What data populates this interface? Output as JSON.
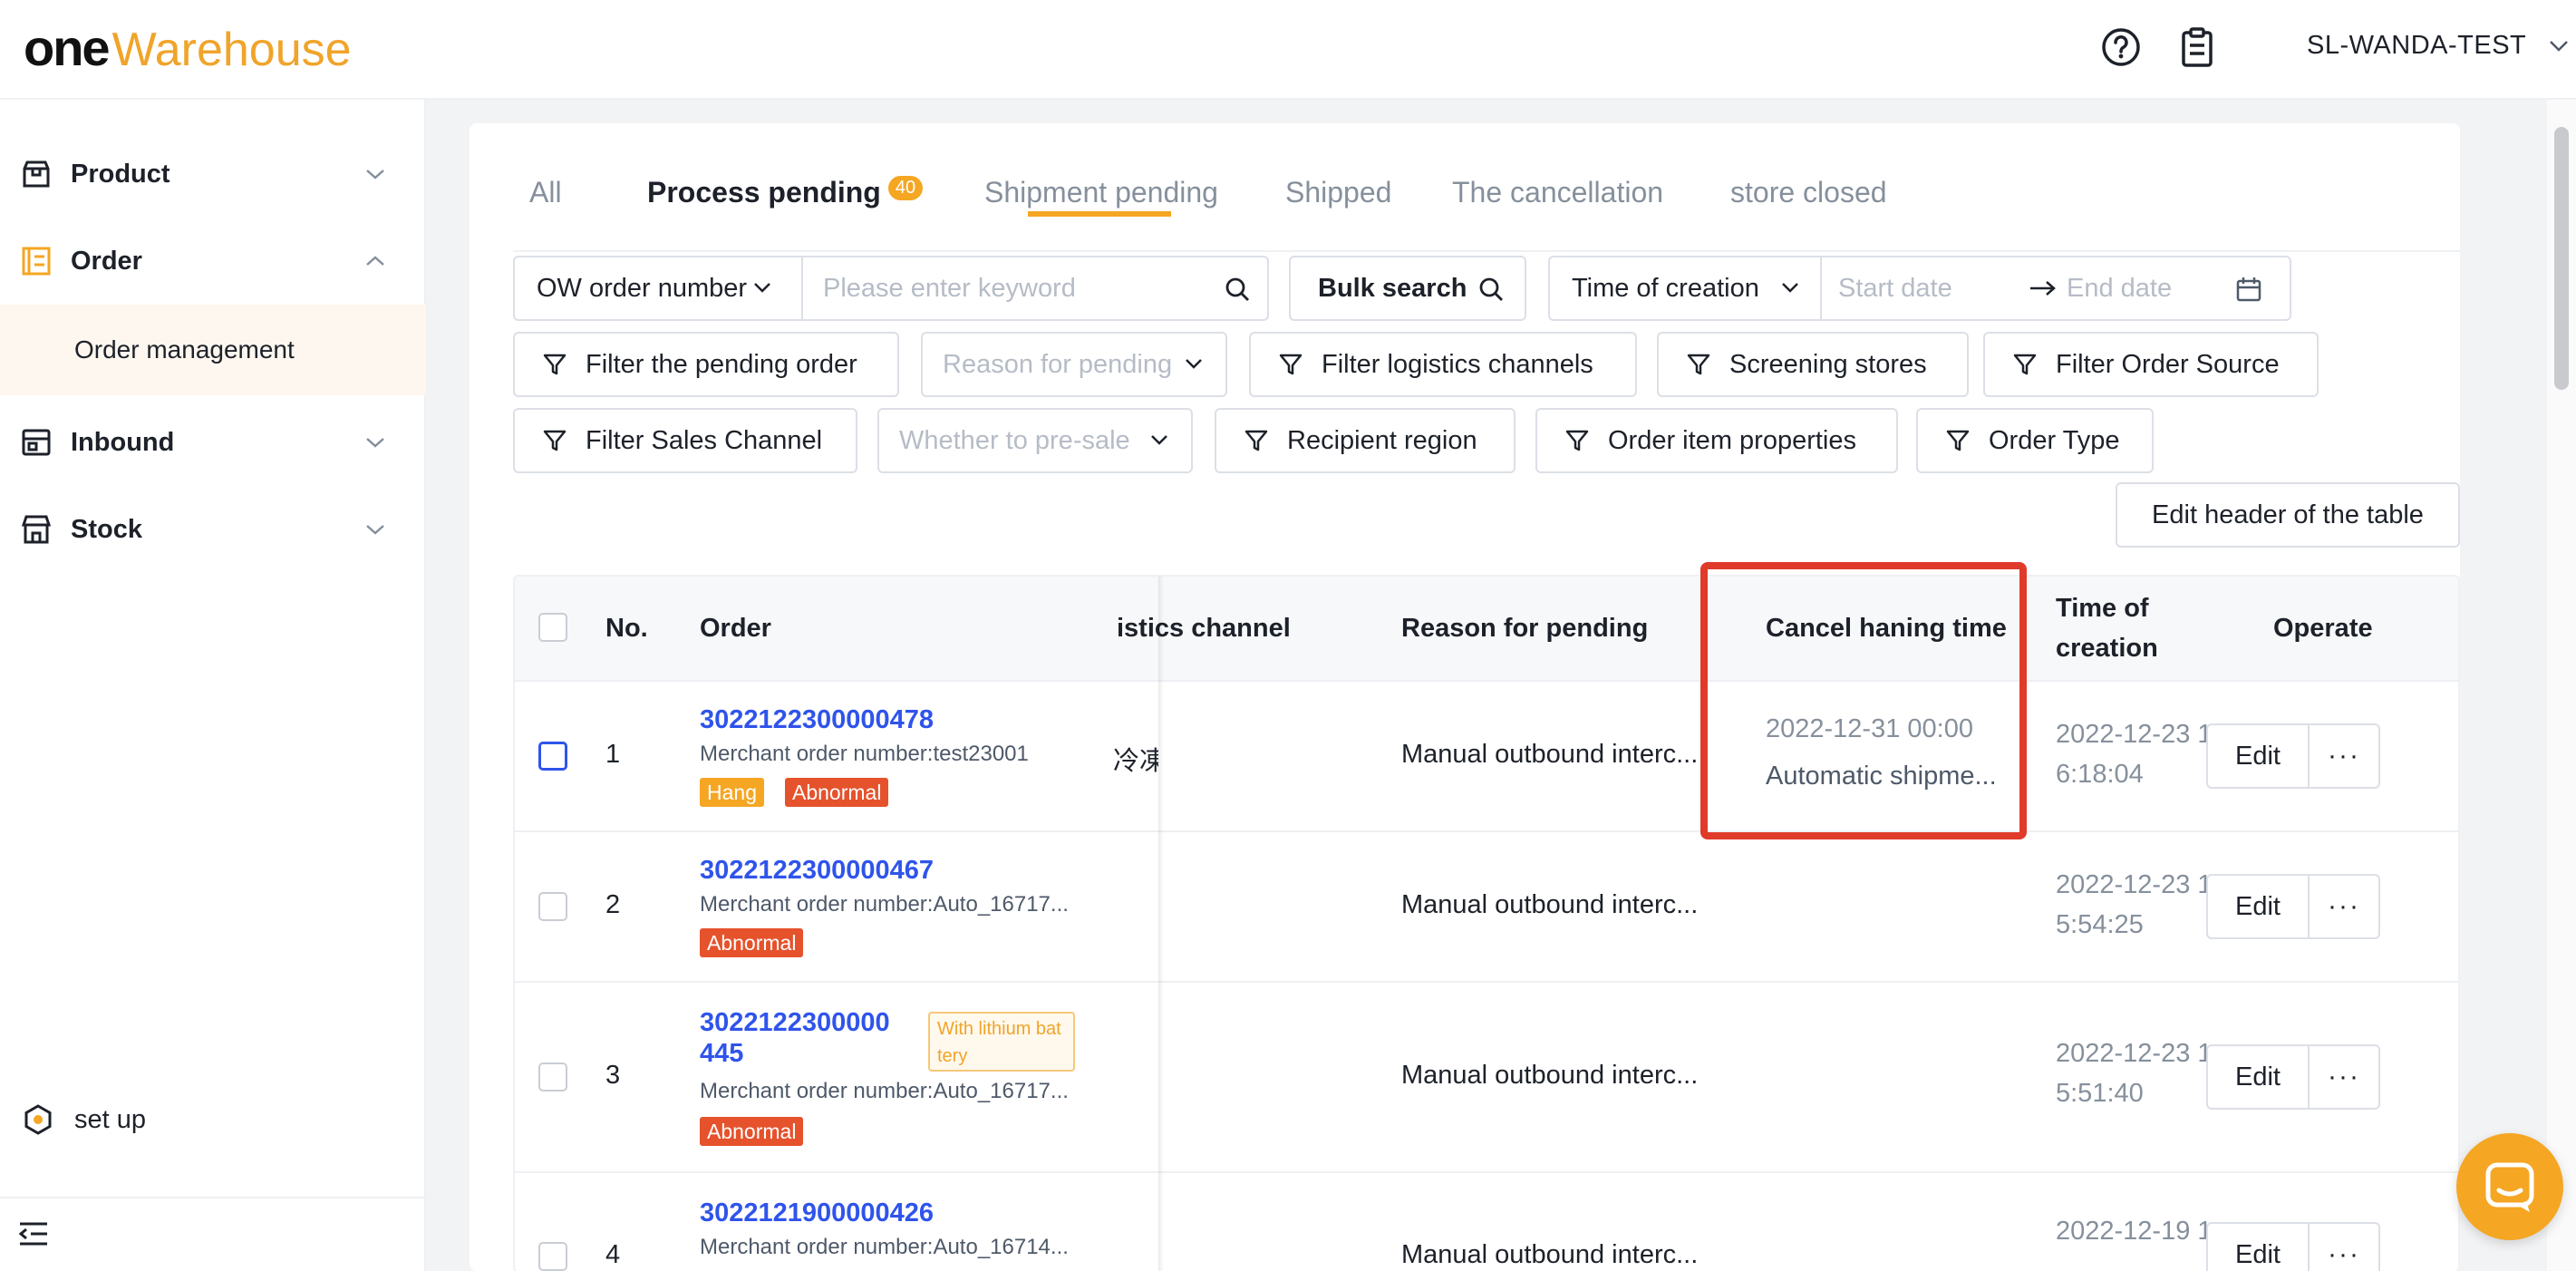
{
  "brand": {
    "logo_one": "one",
    "logo_rest": "Warehouse",
    "accent": "#f5a623"
  },
  "header": {
    "user": "SL-WANDA-TEST",
    "help_icon": "help-circle-icon",
    "notes_icon": "clipboard-icon"
  },
  "sidebar": {
    "items": [
      {
        "label": "Product",
        "icon": "box-icon",
        "expanded": false
      },
      {
        "label": "Order",
        "icon": "order-list-icon",
        "expanded": true
      },
      {
        "label": "Inbound",
        "icon": "inbound-icon",
        "expanded": false
      },
      {
        "label": "Stock",
        "icon": "store-icon",
        "expanded": false
      }
    ],
    "sub_item": "Order management",
    "setup": "set up"
  },
  "tabs": [
    {
      "label": "All"
    },
    {
      "label": "Process pending",
      "badge": "40",
      "active": true
    },
    {
      "label": "Shipment pending"
    },
    {
      "label": "Shipped"
    },
    {
      "label": "The cancellation"
    },
    {
      "label": "store closed"
    }
  ],
  "filters": {
    "order_field_select": "OW order number",
    "keyword_placeholder": "Please enter keyword",
    "bulk_search": "Bulk search",
    "time_select": "Time of creation",
    "start_date_placeholder": "Start date",
    "end_date_placeholder": "End date",
    "filter_pending": "Filter the pending order",
    "reason_placeholder": "Reason for pending",
    "filter_logistics": "Filter logistics channels",
    "screening_stores": "Screening stores",
    "filter_source": "Filter Order Source",
    "filter_sales": "Filter Sales Channel",
    "presale_placeholder": "Whether to pre-sale",
    "recipient_region": "Recipient region",
    "item_properties": "Order item properties",
    "order_type": "Order Type"
  },
  "edit_header_button": "Edit header of the table",
  "table": {
    "columns": {
      "no": "No.",
      "order": "Order",
      "logistics": "istics channel",
      "reason": "Reason for pending",
      "cancel_time": "Cancel haning time",
      "creation_l1": "Time of",
      "creation_l2": "creation",
      "operate": "Operate"
    },
    "rows": [
      {
        "no": "1",
        "order_no": "3022122300000478",
        "merchant": "Merchant order number:test23001",
        "tags": [
          "Hang",
          "Abnormal"
        ],
        "logistics": "冷凍",
        "reason": "Manual outbound interc...",
        "cancel_time": "2022-12-31 00:00",
        "cancel_note": "Automatic shipme...",
        "created_l1": "2022-12-23 1",
        "created_l2": "6:18:04"
      },
      {
        "no": "2",
        "order_no": "3022122300000467",
        "merchant": "Merchant order number:Auto_16717...",
        "tags": [
          "Abnormal"
        ],
        "logistics": "",
        "reason": "Manual outbound interc...",
        "created_l1": "2022-12-23 1",
        "created_l2": "5:54:25"
      },
      {
        "no": "3",
        "order_no_l1": "3022122300000",
        "order_no_l2": "445",
        "lithium_tag": "With lithium bat tery",
        "merchant": "Merchant order number:Auto_16717...",
        "tags": [
          "Abnormal"
        ],
        "logistics": "",
        "reason": "Manual outbound interc...",
        "created_l1": "2022-12-23 1",
        "created_l2": "5:51:40"
      },
      {
        "no": "4",
        "order_no": "3022121900000426",
        "merchant": "Merchant order number:Auto_16714...",
        "tags": [],
        "logistics": "",
        "reason": "Manual outbound interc...",
        "created_l1": "2022-12-19 1",
        "created_l2": ""
      }
    ],
    "edit_label": "Edit",
    "more_label": "···"
  }
}
